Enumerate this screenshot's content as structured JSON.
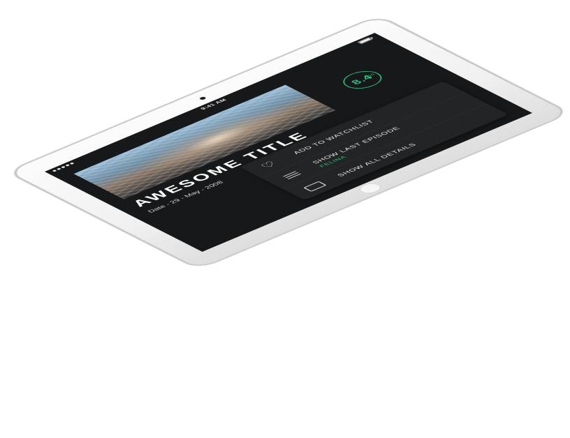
{
  "status_bar": {
    "time": "9:41 AM",
    "signal_icon": "signal-dots-icon",
    "battery_icon": "battery-icon"
  },
  "show": {
    "title": "AWESOME TITLE",
    "date": "Date - 29 - May - 2008",
    "rating": "8.4",
    "rating_unit": "/10"
  },
  "actions": [
    {
      "icon": "heart-icon",
      "label": "ADD TO WATCHLIST"
    },
    {
      "icon": "menu-lines-icon",
      "label": "SHOW LAST EPISODE",
      "sub": "FELINA"
    },
    {
      "icon": "screen-icon",
      "label": "SHOW ALL DETAILS"
    }
  ],
  "colors": {
    "accent": "#2fc17f",
    "screen_bg": "#171819",
    "panel_bg": "#232425",
    "device_body": "#f4f4f4"
  }
}
